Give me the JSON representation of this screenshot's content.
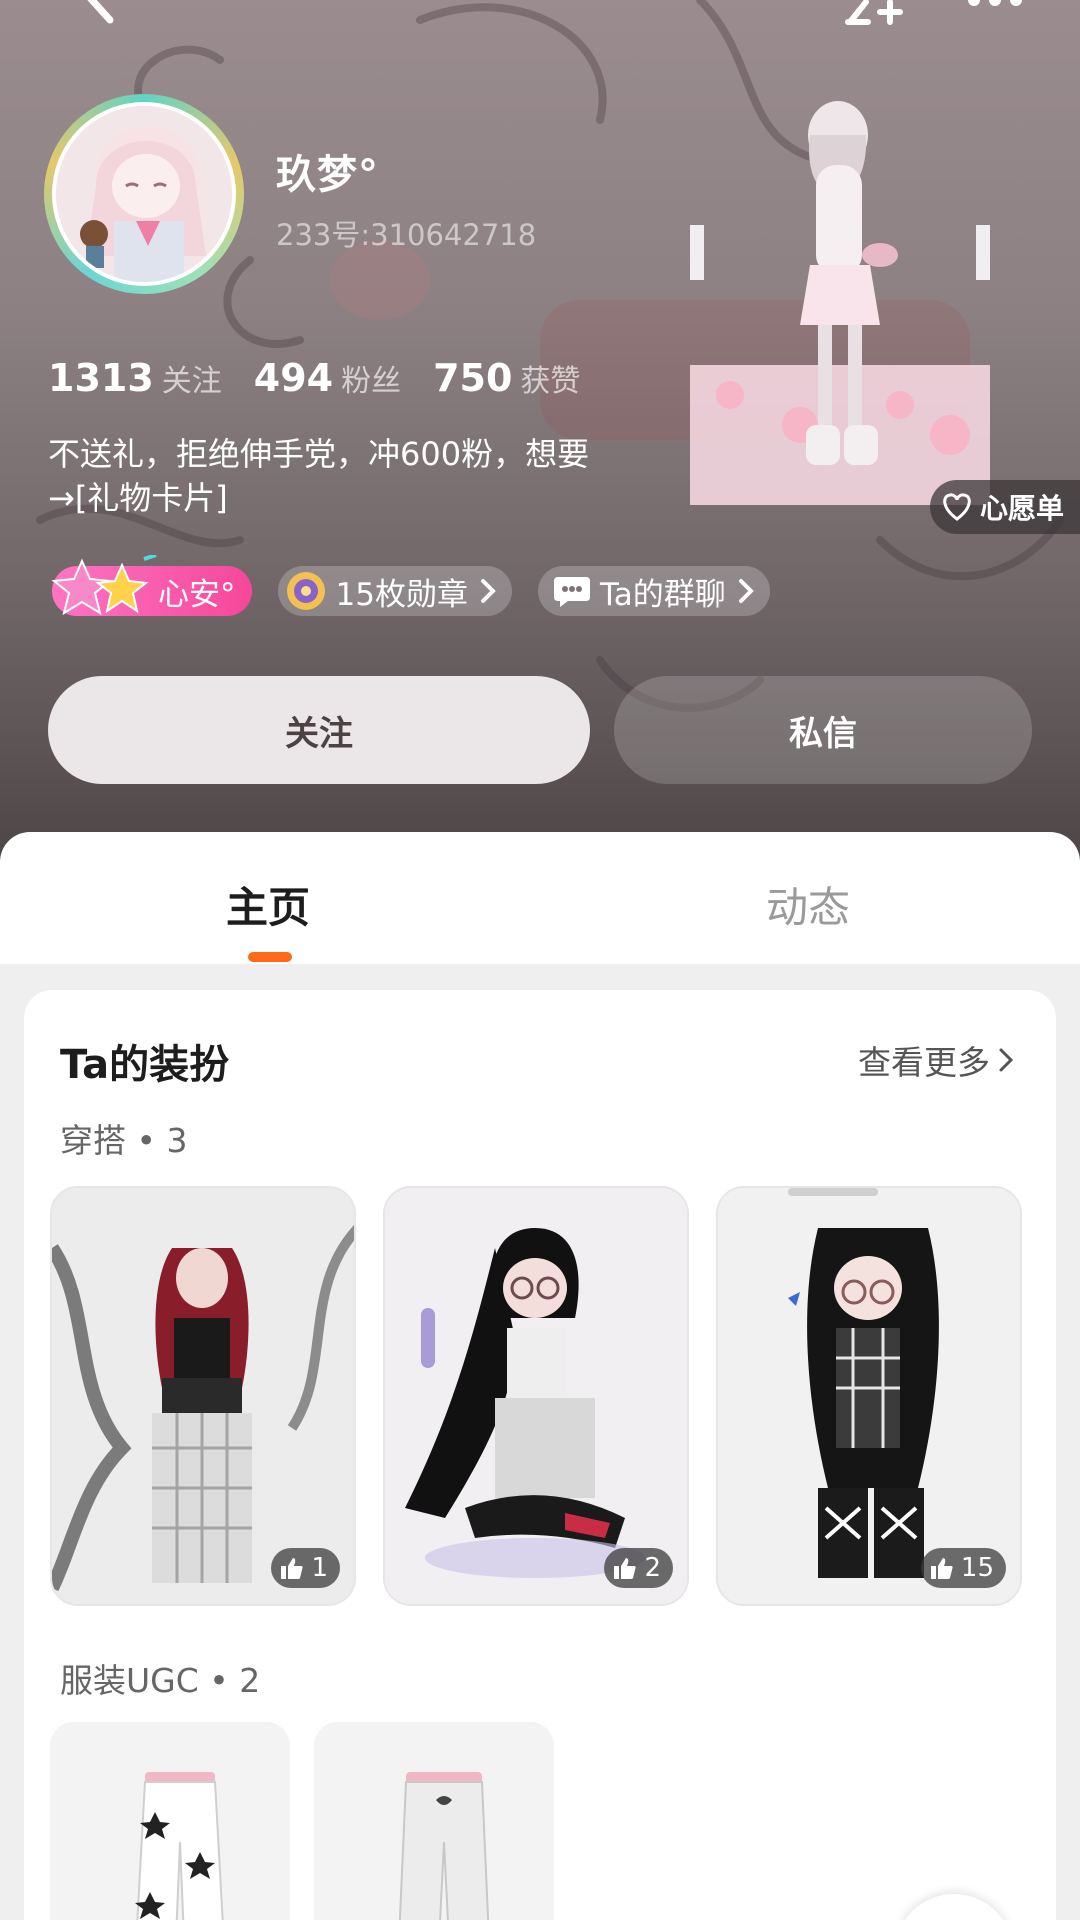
{
  "profile": {
    "name": "玖梦°",
    "id_text": "233号:310642718",
    "bio": "不送礼，拒绝伸手党，冲600粉，想要→[礼物卡片]"
  },
  "stats": [
    {
      "value": "1313",
      "label": "关注"
    },
    {
      "value": "494",
      "label": "粉丝"
    },
    {
      "value": "750",
      "label": "获赞"
    }
  ],
  "wishlist_label": "心愿单",
  "chips": {
    "mood": "心安°",
    "medals": "15枚勋章",
    "group_chat": "Ta的群聊"
  },
  "actions": {
    "follow": "关注",
    "message": "私信"
  },
  "tabs": {
    "home": "主页",
    "feed": "动态"
  },
  "outfit_section": {
    "title": "Ta的装扮",
    "see_more": "查看更多",
    "outfit_label": "穿搭 • 3",
    "ugc_label": "服装UGC • 2",
    "outfits": [
      {
        "likes": "1"
      },
      {
        "likes": "2"
      },
      {
        "likes": "15"
      }
    ]
  },
  "colors": {
    "accent": "#ff6a19",
    "mood_chip": "#f5479a",
    "follow_bg": "#ebe7e8"
  },
  "icons": [
    "back-icon",
    "add-friend-icon",
    "more-icon",
    "heart-icon",
    "chevron-right-icon",
    "chat-bubble-icon",
    "medal-icon",
    "thumbs-up-icon",
    "star-icon"
  ]
}
